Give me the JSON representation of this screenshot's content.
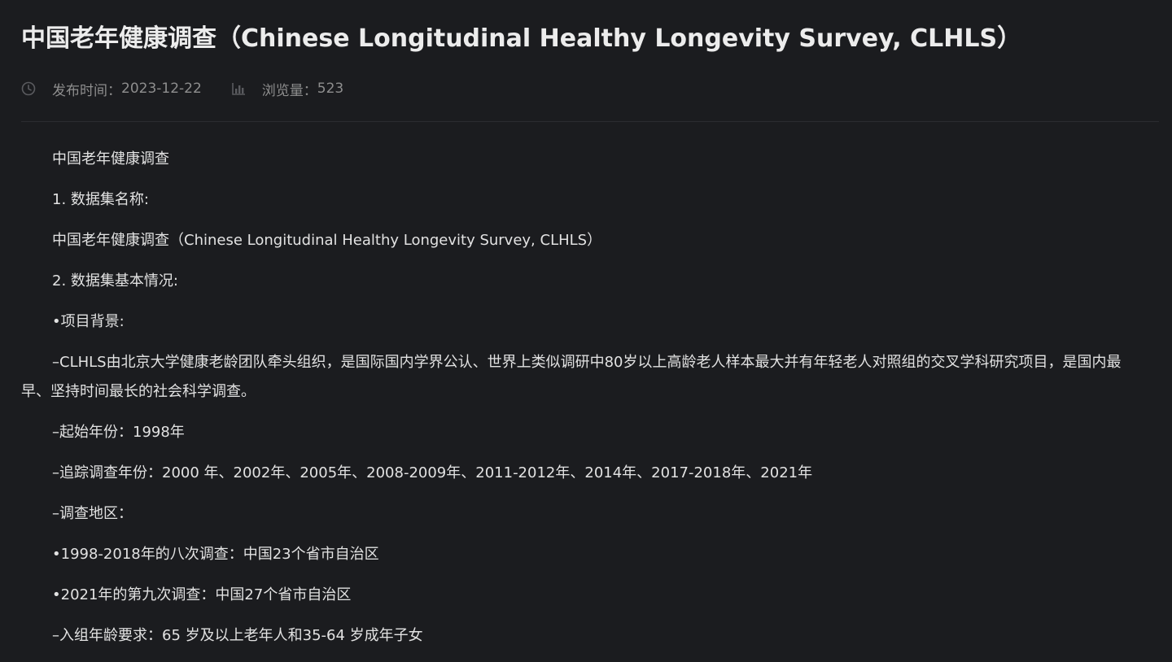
{
  "article": {
    "title": "中国老年健康调查（Chinese Longitudinal Healthy Longevity Survey, CLHLS）",
    "publish_label": "发布时间：",
    "publish_date": "2023-12-22",
    "views_label": "浏览量：",
    "views_count": "523",
    "icons": {
      "publish": "clock-icon",
      "views": "bar-chart-icon"
    }
  },
  "content": {
    "paragraphs": [
      "中国老年健康调查",
      "1. 数据集名称:",
      "中国老年健康调查（Chinese Longitudinal Healthy Longevity Survey, CLHLS）",
      "2. 数据集基本情况:",
      "•项目背景:",
      "–CLHLS由北京大学健康老龄团队牵头组织，是国际国内学界公认、世界上类似调研中80岁以上高龄老人样本最大并有年轻老人对照组的交叉学科研究项目，是国内最早、坚持时间最长的社会科学调查。",
      "–起始年份：1998年",
      "–追踪调查年份：2000 年、2002年、2005年、2008-2009年、2011-2012年、2014年、2017-2018年、2021年",
      "–调查地区：",
      "•1998-2018年的八次调查：中国23个省市自治区",
      "•2021年的第九次调查：中国27个省市自治区",
      "–入组年龄要求：65 岁及以上老年人和35-64 岁成年子女"
    ]
  },
  "colors": {
    "background": "#1b1c1f",
    "title": "#ececec",
    "meta": "#8e8e8e",
    "body_text": "#e2e2e2",
    "divider": "#2b2c30"
  }
}
